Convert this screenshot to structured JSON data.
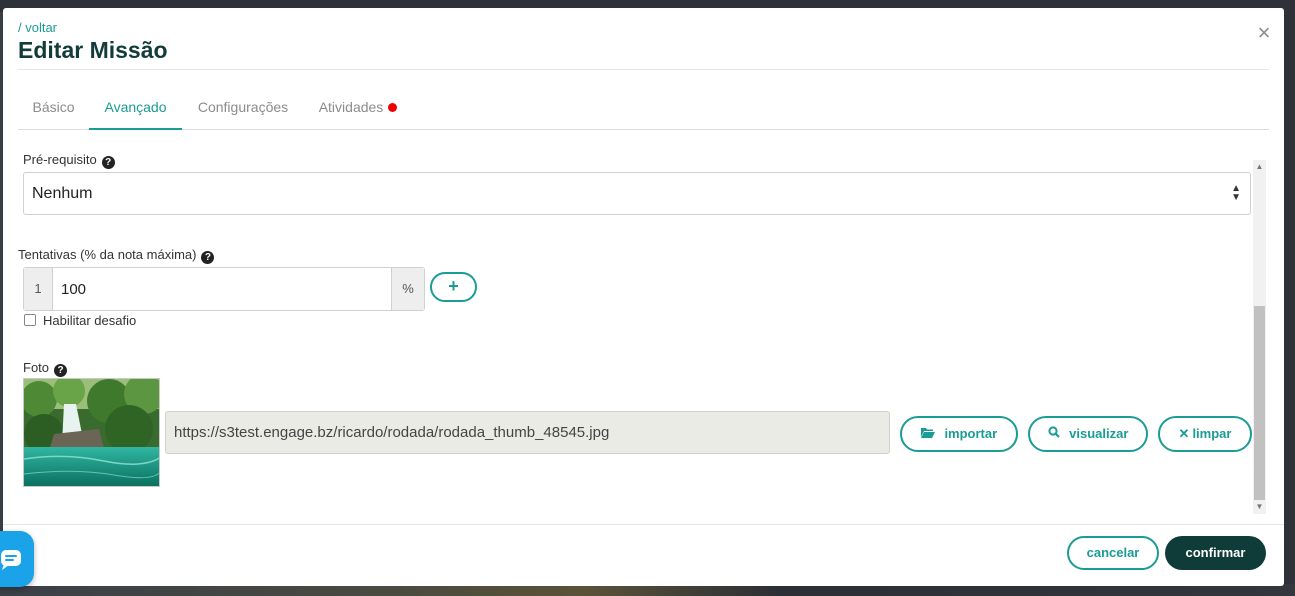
{
  "modal": {
    "back_link": "/ voltar",
    "title": "Editar Missão",
    "close_symbol": "×",
    "tabs": [
      {
        "label": "Básico",
        "active": false
      },
      {
        "label": "Avançado",
        "active": true
      },
      {
        "label": "Configurações",
        "active": false
      },
      {
        "label": "Atividades",
        "active": false,
        "badge_color": "#f00000"
      }
    ]
  },
  "form": {
    "prerequisite": {
      "label": "Pré-requisito",
      "value": "Nenhum"
    },
    "attempts": {
      "label": "Tentativas (% da nota máxima)",
      "index": "1",
      "value": "100",
      "suffix": "%",
      "add_symbol": "+"
    },
    "challenge": {
      "label": "Habilitar desafio",
      "checked": false
    },
    "photo": {
      "label": "Foto",
      "url": "https://s3test.engage.bz/ricardo/rodada/rodada_thumb_48545.jpg",
      "import_label": "importar",
      "view_label": "visualizar",
      "clear_label": "limpar"
    }
  },
  "footer": {
    "cancel_label": "cancelar",
    "confirm_label": "confirmar"
  },
  "icons": {
    "help": "question-circle-icon",
    "folder": "folder-open-icon",
    "search": "search-icon",
    "clear": "times-icon",
    "chat": "chat-bubble-icon"
  },
  "colors": {
    "accent": "#1a9c94",
    "primary_dark": "#0f3b38",
    "title": "#123c3a",
    "badge": "#f00000",
    "chat": "#1aa3e8"
  }
}
